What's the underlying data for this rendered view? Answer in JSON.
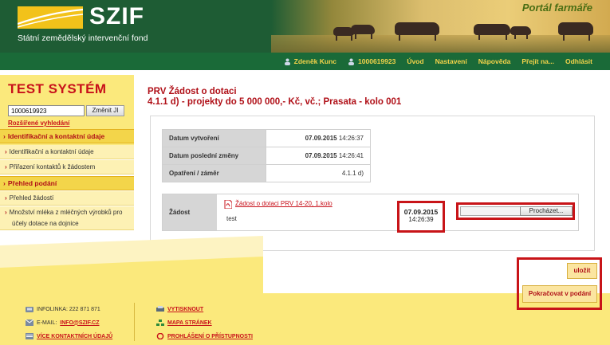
{
  "header": {
    "logo_text": "SZIF",
    "logo_subtitle": "Státní zemědělský intervenční fond",
    "portal_name": "Portál farmáře"
  },
  "navbar": {
    "user_name": "Zdeněk Kunc",
    "user_id": "1000619923",
    "items": [
      "Úvod",
      "Nastavení",
      "Nápověda",
      "Přejít na...",
      "Odhlásit"
    ],
    "user_icon": "person-icon"
  },
  "sidebar": {
    "title": "TEST SYSTÉM",
    "search_value": "1000619923",
    "change_button": "Změnit JI",
    "extended_search": "Rozšířené vyhledání",
    "sections": [
      {
        "label": "Identifikační a kontaktní údaje",
        "items": [
          "Identifikační a kontaktní údaje",
          "Přiřazení kontaktů k žádostem"
        ]
      },
      {
        "label": "Přehled podání",
        "items": [
          "Přehled žádostí",
          "Množství mléka z mléčných výrobků pro",
          "účely dotace na dojnice"
        ]
      }
    ]
  },
  "main": {
    "title_line1": "PRV Žádost o dotaci",
    "title_line2": "4.1.1 d) - projekty do 5 000 000,- Kč, vč.; Prasata - kolo 001",
    "info": [
      {
        "label": "Datum vytvoření",
        "date": "07.09.2015",
        "time": "14:26:37"
      },
      {
        "label": "Datum poslední změny",
        "date": "07.09.2015",
        "time": "14:26:41"
      },
      {
        "label": "Opatření / záměr",
        "value": "4.1.1 d)"
      }
    ],
    "zadost": {
      "label": "Žádost",
      "file_link": "Žádost o dotaci PRV 14-20, 1.kolo",
      "note": "test",
      "date": "07.09.2015",
      "time": "14:26:39",
      "browse_button": "Procházet..."
    },
    "actions": {
      "save": "uložit",
      "continue": "Pokračovat v podání"
    }
  },
  "footer": {
    "infolinka": "INFOLINKA: 222 871 871",
    "email_label": "E-MAIL:",
    "email": "INFO@SZIF.CZ",
    "contacts": "VÍCE KONTAKTNÍCH ÚDAJŮ",
    "print": "VYTISKNOUT",
    "sitemap": "MAPA STRÁNEK",
    "accessibility": "PROHLÁŠENÍ O PŘÍSTUPNOSTI"
  },
  "colors": {
    "brand_green": "#1e5c34",
    "accent_yellow": "#f2c21a",
    "brand_red": "#c8101a",
    "highlight_red": "#c81418"
  }
}
